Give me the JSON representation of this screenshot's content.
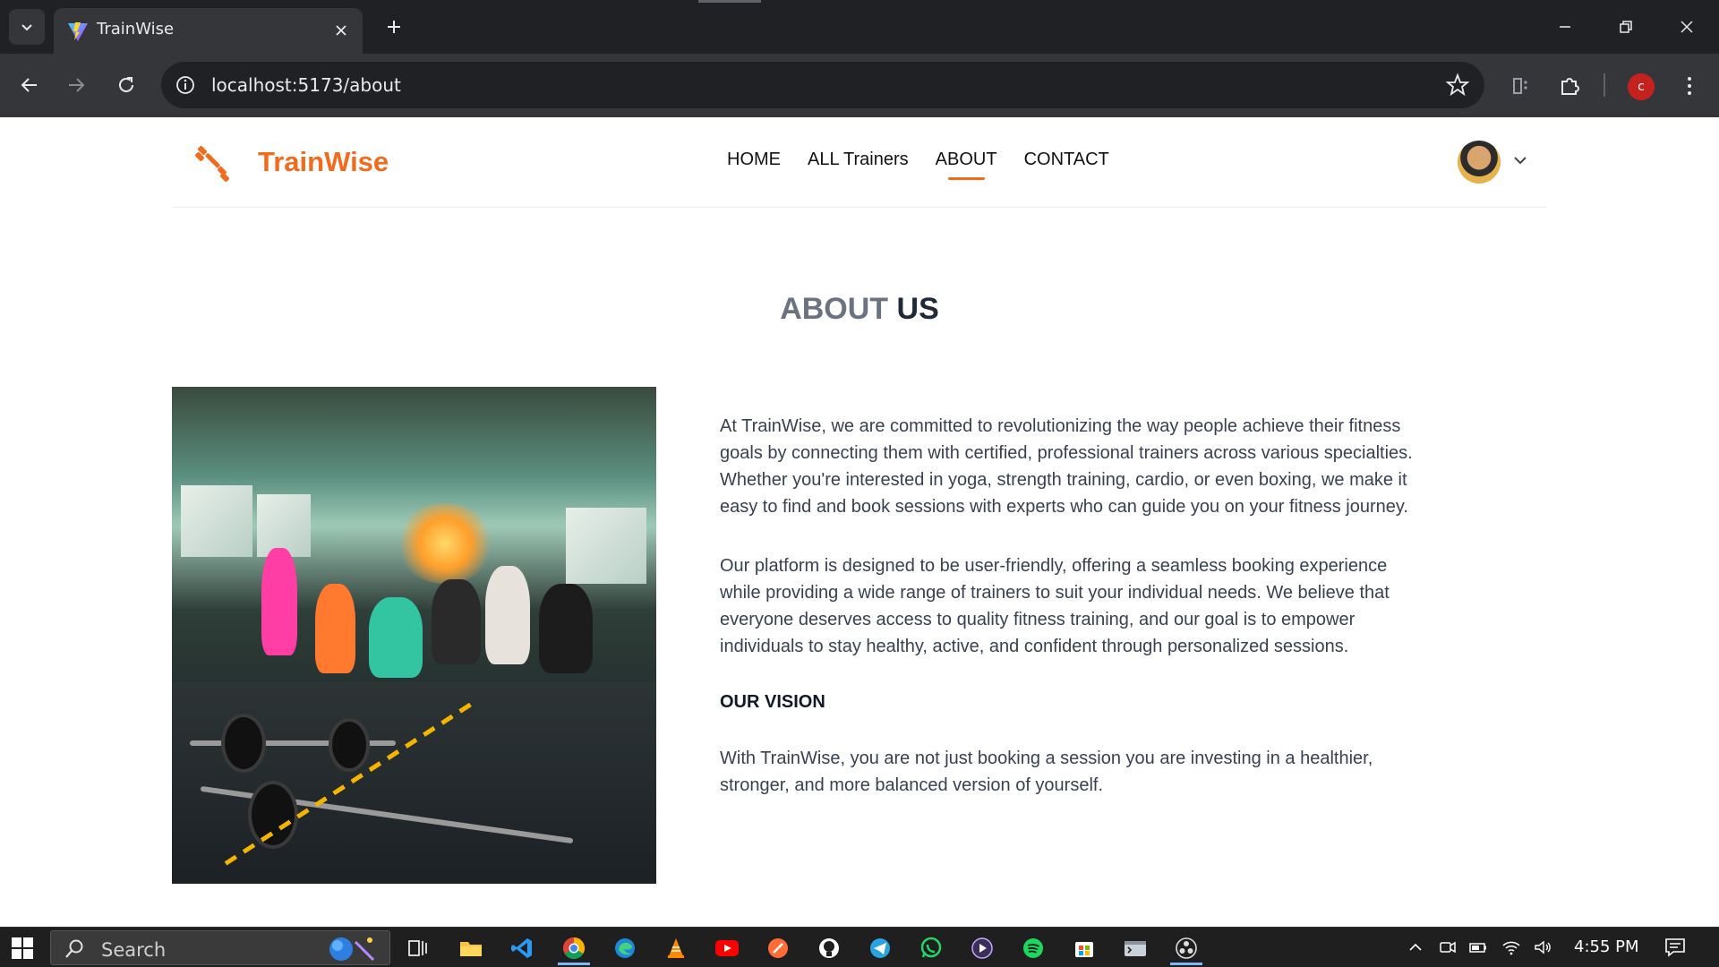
{
  "browser": {
    "tab_title": "TrainWise",
    "url": "localhost:5173/about",
    "profile_initial": "c"
  },
  "site": {
    "logo_text": "TrainWise",
    "nav": [
      {
        "label": "HOME",
        "active": false
      },
      {
        "label": "ALL Trainers",
        "active": false
      },
      {
        "label": "ABOUT",
        "active": true
      },
      {
        "label": "CONTACT",
        "active": false
      }
    ],
    "accent_color": "#f26b1d"
  },
  "about": {
    "title_light": "ABOUT",
    "title_bold": "US",
    "paragraph_1": "At TrainWise, we are committed to revolutionizing the way people achieve their fitness goals by connecting them with certified, professional trainers across various specialties. Whether you're interested in yoga, strength training, cardio, or even boxing, we make it easy to find and book sessions with experts who can guide you on your fitness journey.",
    "paragraph_2": "Our platform is designed to be user-friendly, offering a seamless booking experience while providing a wide range of trainers to suit your individual needs. We believe that everyone deserves access to quality fitness training, and our goal is to empower individuals to stay healthy, active, and confident through personalized sessions.",
    "vision_heading": "OUR VISION",
    "vision_text": "With TrainWise, you are not just booking a session you are investing in a healthier, stronger, and more balanced version of yourself."
  },
  "taskbar": {
    "search_placeholder": "Search",
    "clock": "4:55 PM",
    "apps": [
      "task-view",
      "file-explorer",
      "vscode",
      "chrome",
      "edge",
      "vlc",
      "youtube",
      "postman",
      "github",
      "telegram",
      "whatsapp",
      "media-player",
      "spotify",
      "store",
      "terminal",
      "obs"
    ]
  }
}
